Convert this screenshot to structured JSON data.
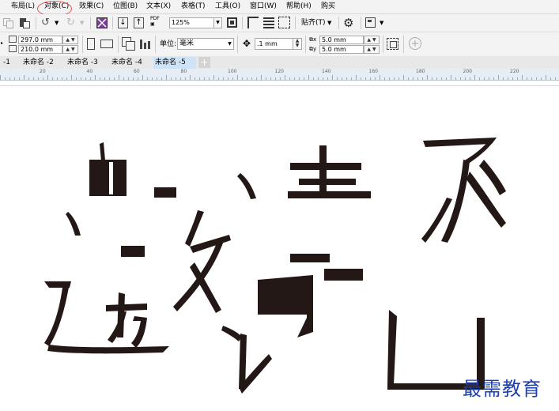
{
  "menu": {
    "items": [
      "布局(L)",
      "对象(C)",
      "效果(C)",
      "位图(B)",
      "文本(X)",
      "表格(T)",
      "工具(O)",
      "窗口(W)",
      "帮助(H)",
      "购买"
    ]
  },
  "toolbar": {
    "zoom_value": "125%",
    "snap_label": "贴齐(T)"
  },
  "property_bar": {
    "width_value": "297.0 mm",
    "height_value": "210.0 mm",
    "units_label": "单位:",
    "units_value": "毫米",
    "nudge_value": ".1 mm",
    "dup_x_value": "5.0 mm",
    "dup_y_value": "5.0 mm"
  },
  "tabs": [
    "-1",
    "未命名 -2",
    "未命名 -3",
    "未命名 -4",
    "未命名 -5"
  ],
  "active_tab_index": 4,
  "ruler": {
    "labels": [
      "20",
      "40",
      "60",
      "80",
      "100",
      "120",
      "140",
      "160",
      "180",
      "200",
      "220"
    ]
  },
  "watermark": "最需教育",
  "colors": {
    "ink": "#231815",
    "highlight_circle": "#e2564f",
    "watermark": "#1b3fb5",
    "active_tab": "#cfe3f7"
  }
}
